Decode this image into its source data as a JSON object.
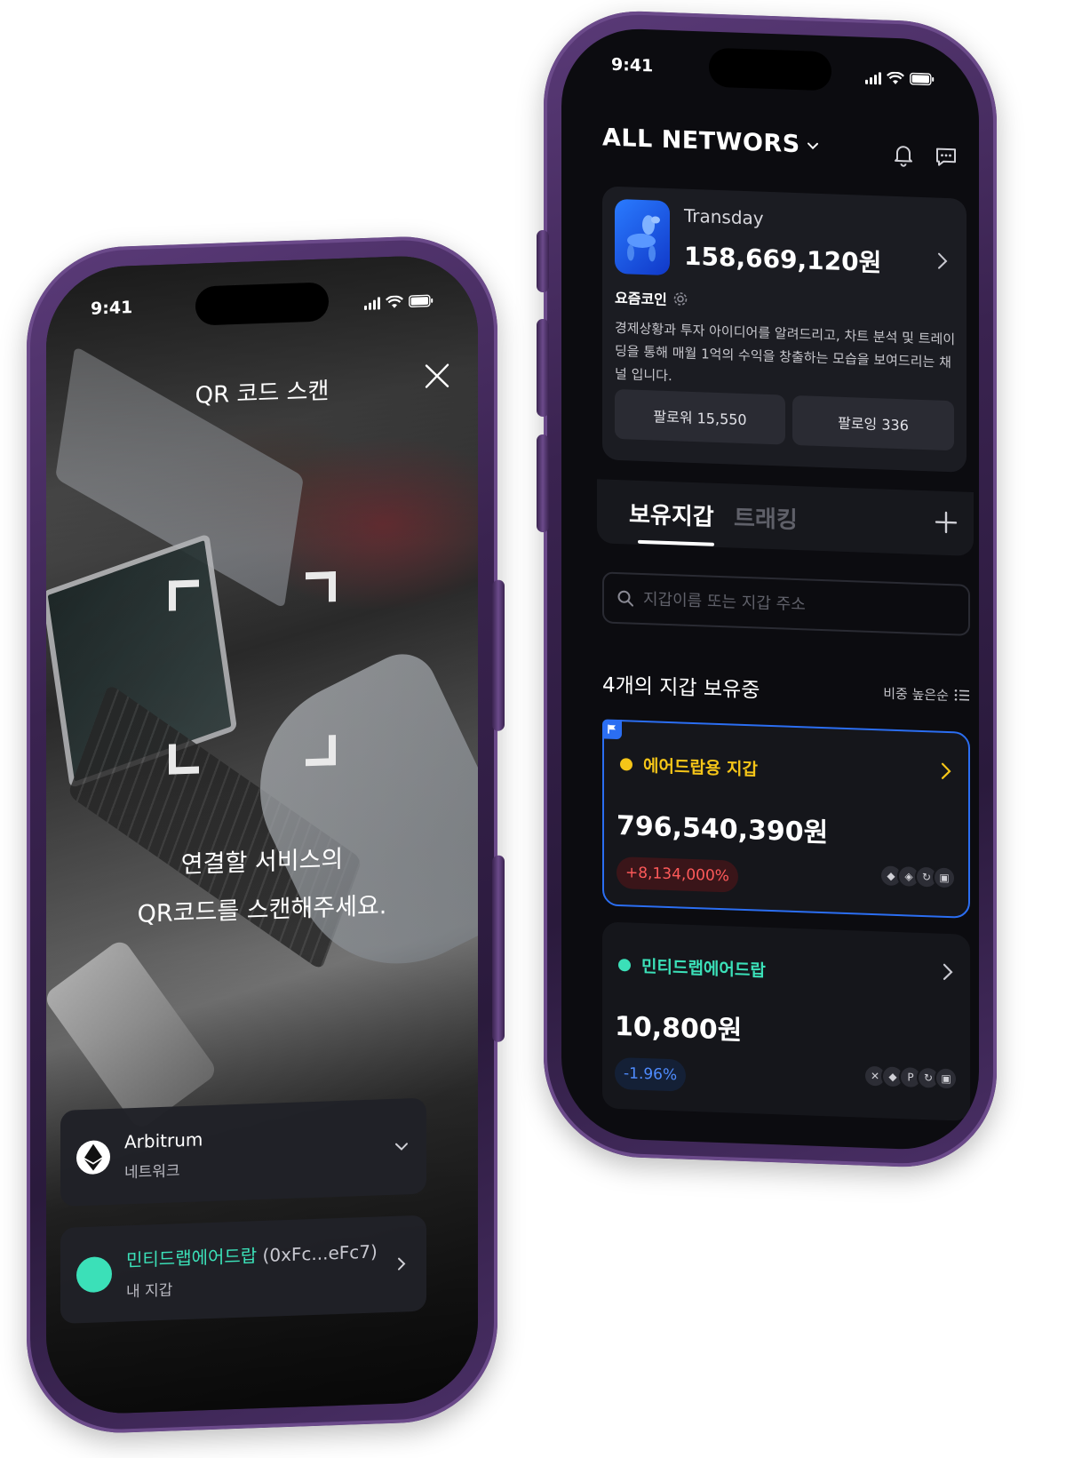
{
  "left_phone": {
    "status_time": "9:41",
    "title": "QR 코드 스캔",
    "instruction": "연결할 서비스의\nQR코드를 스캔해주세요.",
    "network_panel": {
      "name": "Arbitrum",
      "caption": "네트워크"
    },
    "wallet_panel": {
      "name": "민티드랩에어드랍",
      "address": " (0xFc...eFc7)",
      "caption": "내 지갑"
    }
  },
  "right_phone": {
    "status_time": "9:41",
    "networks_label": "ALL NETWORS",
    "profile": {
      "name": "Transday",
      "amount": "158,669,120원",
      "channel": "요즘코인",
      "description": "경제상황과 투자 아이디어를 알려드리고, 차트 분석 및 트레이딩을 통해 매월 1억의 수익을 창출하는 모습을 보여드리는 채널 입니다.",
      "follower_label": "팔로워 15,550",
      "following_label": "팔로잉 336"
    },
    "tabs": [
      {
        "label": "보유지갑",
        "active": true
      },
      {
        "label": "트래킹",
        "active": false
      }
    ],
    "search": {
      "placeholder": "지갑이름 또는 지갑 주소"
    },
    "wallet_count_label": "4개의 지갑 보유중",
    "sort_label": "비중 높은순",
    "wallets": [
      {
        "name": "에어드랍용 지갑",
        "amount": "796,540,390원",
        "change": "+8,134,000%",
        "dot_color": "#f5c518",
        "name_color": "#f5c518",
        "featured": true
      },
      {
        "name": "민티드랩에어드랍",
        "amount": "10,800원",
        "change": "-1.96%",
        "dot_color": "#3be0b8",
        "name_color": "#3be0b8",
        "featured": false
      }
    ]
  },
  "colors": {
    "accent_blue": "#2b6ef2",
    "mint": "#3be0b8",
    "gold": "#f5c518",
    "positive_red": "#ff5a5a",
    "negative_blue": "#4f8cff",
    "phone_frame": "#3a2350"
  }
}
